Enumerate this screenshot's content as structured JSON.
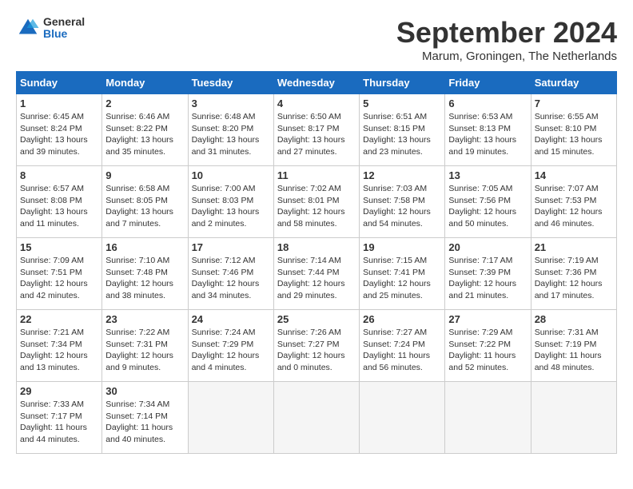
{
  "header": {
    "logo_general": "General",
    "logo_blue": "Blue",
    "title": "September 2024",
    "location": "Marum, Groningen, The Netherlands"
  },
  "days_of_week": [
    "Sunday",
    "Monday",
    "Tuesday",
    "Wednesday",
    "Thursday",
    "Friday",
    "Saturday"
  ],
  "weeks": [
    [
      {
        "num": "1",
        "info": "Sunrise: 6:45 AM\nSunset: 8:24 PM\nDaylight: 13 hours\nand 39 minutes."
      },
      {
        "num": "2",
        "info": "Sunrise: 6:46 AM\nSunset: 8:22 PM\nDaylight: 13 hours\nand 35 minutes."
      },
      {
        "num": "3",
        "info": "Sunrise: 6:48 AM\nSunset: 8:20 PM\nDaylight: 13 hours\nand 31 minutes."
      },
      {
        "num": "4",
        "info": "Sunrise: 6:50 AM\nSunset: 8:17 PM\nDaylight: 13 hours\nand 27 minutes."
      },
      {
        "num": "5",
        "info": "Sunrise: 6:51 AM\nSunset: 8:15 PM\nDaylight: 13 hours\nand 23 minutes."
      },
      {
        "num": "6",
        "info": "Sunrise: 6:53 AM\nSunset: 8:13 PM\nDaylight: 13 hours\nand 19 minutes."
      },
      {
        "num": "7",
        "info": "Sunrise: 6:55 AM\nSunset: 8:10 PM\nDaylight: 13 hours\nand 15 minutes."
      }
    ],
    [
      {
        "num": "8",
        "info": "Sunrise: 6:57 AM\nSunset: 8:08 PM\nDaylight: 13 hours\nand 11 minutes."
      },
      {
        "num": "9",
        "info": "Sunrise: 6:58 AM\nSunset: 8:05 PM\nDaylight: 13 hours\nand 7 minutes."
      },
      {
        "num": "10",
        "info": "Sunrise: 7:00 AM\nSunset: 8:03 PM\nDaylight: 13 hours\nand 2 minutes."
      },
      {
        "num": "11",
        "info": "Sunrise: 7:02 AM\nSunset: 8:01 PM\nDaylight: 12 hours\nand 58 minutes."
      },
      {
        "num": "12",
        "info": "Sunrise: 7:03 AM\nSunset: 7:58 PM\nDaylight: 12 hours\nand 54 minutes."
      },
      {
        "num": "13",
        "info": "Sunrise: 7:05 AM\nSunset: 7:56 PM\nDaylight: 12 hours\nand 50 minutes."
      },
      {
        "num": "14",
        "info": "Sunrise: 7:07 AM\nSunset: 7:53 PM\nDaylight: 12 hours\nand 46 minutes."
      }
    ],
    [
      {
        "num": "15",
        "info": "Sunrise: 7:09 AM\nSunset: 7:51 PM\nDaylight: 12 hours\nand 42 minutes."
      },
      {
        "num": "16",
        "info": "Sunrise: 7:10 AM\nSunset: 7:48 PM\nDaylight: 12 hours\nand 38 minutes."
      },
      {
        "num": "17",
        "info": "Sunrise: 7:12 AM\nSunset: 7:46 PM\nDaylight: 12 hours\nand 34 minutes."
      },
      {
        "num": "18",
        "info": "Sunrise: 7:14 AM\nSunset: 7:44 PM\nDaylight: 12 hours\nand 29 minutes."
      },
      {
        "num": "19",
        "info": "Sunrise: 7:15 AM\nSunset: 7:41 PM\nDaylight: 12 hours\nand 25 minutes."
      },
      {
        "num": "20",
        "info": "Sunrise: 7:17 AM\nSunset: 7:39 PM\nDaylight: 12 hours\nand 21 minutes."
      },
      {
        "num": "21",
        "info": "Sunrise: 7:19 AM\nSunset: 7:36 PM\nDaylight: 12 hours\nand 17 minutes."
      }
    ],
    [
      {
        "num": "22",
        "info": "Sunrise: 7:21 AM\nSunset: 7:34 PM\nDaylight: 12 hours\nand 13 minutes."
      },
      {
        "num": "23",
        "info": "Sunrise: 7:22 AM\nSunset: 7:31 PM\nDaylight: 12 hours\nand 9 minutes."
      },
      {
        "num": "24",
        "info": "Sunrise: 7:24 AM\nSunset: 7:29 PM\nDaylight: 12 hours\nand 4 minutes."
      },
      {
        "num": "25",
        "info": "Sunrise: 7:26 AM\nSunset: 7:27 PM\nDaylight: 12 hours\nand 0 minutes."
      },
      {
        "num": "26",
        "info": "Sunrise: 7:27 AM\nSunset: 7:24 PM\nDaylight: 11 hours\nand 56 minutes."
      },
      {
        "num": "27",
        "info": "Sunrise: 7:29 AM\nSunset: 7:22 PM\nDaylight: 11 hours\nand 52 minutes."
      },
      {
        "num": "28",
        "info": "Sunrise: 7:31 AM\nSunset: 7:19 PM\nDaylight: 11 hours\nand 48 minutes."
      }
    ],
    [
      {
        "num": "29",
        "info": "Sunrise: 7:33 AM\nSunset: 7:17 PM\nDaylight: 11 hours\nand 44 minutes."
      },
      {
        "num": "30",
        "info": "Sunrise: 7:34 AM\nSunset: 7:14 PM\nDaylight: 11 hours\nand 40 minutes."
      },
      {
        "num": "",
        "info": ""
      },
      {
        "num": "",
        "info": ""
      },
      {
        "num": "",
        "info": ""
      },
      {
        "num": "",
        "info": ""
      },
      {
        "num": "",
        "info": ""
      }
    ]
  ]
}
